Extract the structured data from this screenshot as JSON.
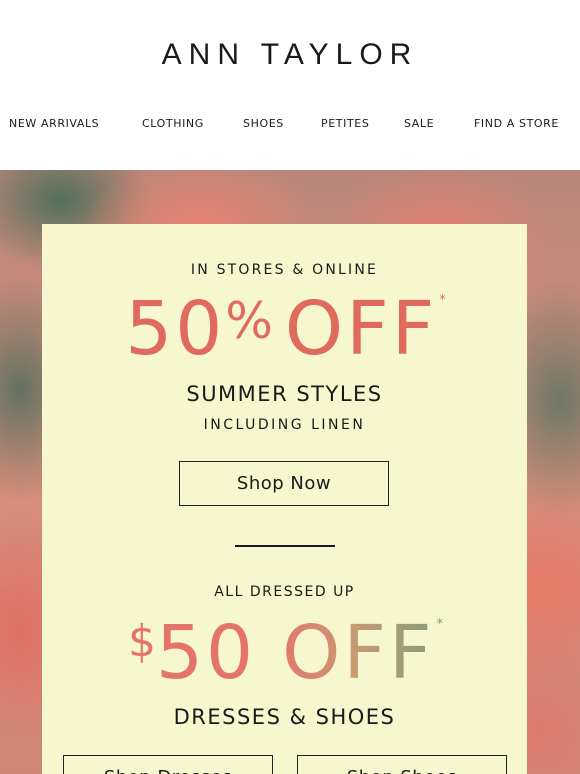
{
  "brand": {
    "logo": "ANN TAYLOR"
  },
  "nav": [
    {
      "label": "NEW ARRIVALS"
    },
    {
      "label": "CLOTHING"
    },
    {
      "label": "SHOES"
    },
    {
      "label": "PETITES"
    },
    {
      "label": "SALE"
    },
    {
      "label": "FIND A STORE"
    }
  ],
  "promo1": {
    "kicker": "IN STORES & ONLINE",
    "amount": "50",
    "percent": "%",
    "off": "OFF",
    "asterisk": "*",
    "headline": "SUMMER STYLES",
    "subline": "INCLUDING LINEN",
    "cta": "Shop Now"
  },
  "promo2": {
    "kicker": "ALL DRESSED UP",
    "currency": "$",
    "amount": "50",
    "off": "OFF",
    "asterisk": "*",
    "headline": "DRESSES & SHOES",
    "cta_dresses": "Shop Dresses",
    "cta_shoes": "Shop Shoes"
  },
  "colors": {
    "accent_coral": "#e06a5c",
    "card_background": "#f6f6cf",
    "text": "#1a1a1a"
  }
}
